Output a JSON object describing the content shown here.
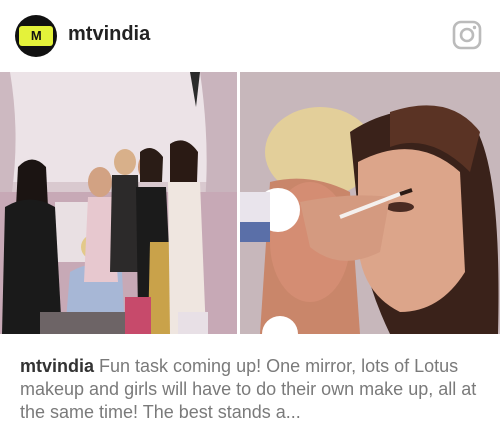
{
  "post": {
    "username": "mtvindia",
    "avatar_logo_text": "M",
    "caption_user": "mtvindia",
    "caption_text": " Fun task coming up! One mirror, lots of Lotus makeup and girls will have to do their own make up, all at the same time! The best stands a..."
  },
  "icons": {
    "app": "instagram-icon"
  },
  "colors": {
    "logo_bg": "#e4f23a",
    "avatar_bg": "#111111",
    "caption_text": "#7a7a7a",
    "username_text": "#222222"
  }
}
